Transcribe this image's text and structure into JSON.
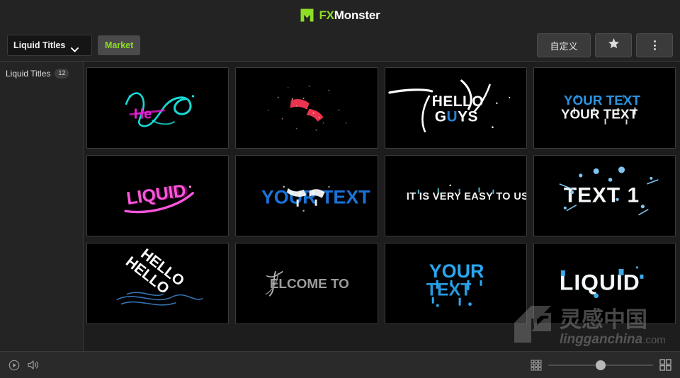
{
  "app": {
    "logo": {
      "icon": "monster-m-icon",
      "text_primary": "FX",
      "text_secondary": "Monster",
      "color_accent": "#8ede26",
      "color_text": "#ffffff"
    }
  },
  "toolbar": {
    "category_dropdown": {
      "value": "Liquid Titles",
      "icon": "chevron-down-icon"
    },
    "market_button": {
      "label": "Market",
      "color": "#8ede26"
    },
    "customize_button": {
      "label": "自定义"
    },
    "favorite_button": {
      "icon": "star-icon"
    },
    "more_button": {
      "icon": "three-dots-vertical-icon"
    }
  },
  "sidebar": {
    "items": [
      {
        "label": "Liquid Titles",
        "badge": "12"
      }
    ]
  },
  "grid": {
    "items": [
      {
        "id": 1,
        "title": "Hello",
        "style": "abstract-cyan-magenta"
      },
      {
        "id": 2,
        "title": "",
        "style": "red-particles"
      },
      {
        "id": 3,
        "title": "HELLO GUYS",
        "style": "white-brush"
      },
      {
        "id": 4,
        "title": "YOUR TEXT",
        "style": "blue-white-double"
      },
      {
        "id": 5,
        "title": "LIQUID",
        "style": "magenta-neon"
      },
      {
        "id": 6,
        "title": "YOUR TEXT",
        "style": "blue-splash"
      },
      {
        "id": 7,
        "title": "IT IS VERY EASY TO USE!",
        "style": "white-thin"
      },
      {
        "id": 8,
        "title": "TEXT 1",
        "style": "white-blue-droplets"
      },
      {
        "id": 9,
        "title": "HELLO HELLO",
        "style": "tilted-white-waves"
      },
      {
        "id": 10,
        "title": "WELCOME TO",
        "style": "dim-gray"
      },
      {
        "id": 11,
        "title": "YOUR TEXT",
        "style": "bright-blue-drip"
      },
      {
        "id": 12,
        "title": "LIQUID",
        "style": "white-blue"
      }
    ]
  },
  "watermark": {
    "text_cn": "灵感中国",
    "text_en": "lingganchina",
    "domain": ".com"
  },
  "bottombar": {
    "play_button": {
      "icon": "play-circle-icon"
    },
    "volume_button": {
      "icon": "speaker-icon"
    },
    "small_grid_button": {
      "icon": "grid-small-icon"
    },
    "large_grid_button": {
      "icon": "grid-large-icon"
    },
    "zoom_slider": {
      "value": 50,
      "min": 0,
      "max": 100
    }
  }
}
